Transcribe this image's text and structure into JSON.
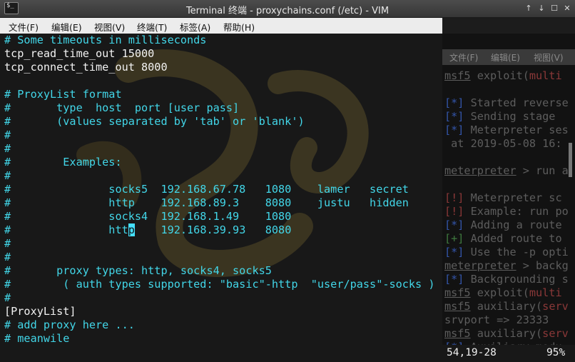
{
  "window": {
    "title": "Terminal 终端 - proxychains.conf (/etc) - VIM",
    "icon": "$_",
    "buttons": [
      "↑",
      "↓",
      "☐",
      "✕"
    ]
  },
  "menu": [
    "文件(F)",
    "编辑(E)",
    "视图(V)",
    "终端(T)",
    "标签(A)",
    "帮助(H)"
  ],
  "vim_lines": [
    {
      "text": "# Some timeouts in milliseconds",
      "type": "comment"
    },
    {
      "text": "tcp_read_time_out 15000",
      "type": "text"
    },
    {
      "text": "tcp_connect_time_out 8000",
      "type": "text"
    },
    {
      "text": "",
      "type": "text"
    },
    {
      "text": "# ProxyList format",
      "type": "comment"
    },
    {
      "text": "#       type  host  port [user pass]",
      "type": "comment"
    },
    {
      "text": "#       (values separated by 'tab' or 'blank')",
      "type": "comment"
    },
    {
      "text": "#",
      "type": "comment"
    },
    {
      "text": "#",
      "type": "comment"
    },
    {
      "text": "#        Examples:",
      "type": "comment"
    },
    {
      "text": "#",
      "type": "comment"
    },
    {
      "text": "#               socks5  192.168.67.78   1080    lamer   secret",
      "type": "comment"
    },
    {
      "text": "#               http    192.168.89.3    8080    justu   hidden",
      "type": "comment"
    },
    {
      "text": "#               socks4  192.168.1.49    1080",
      "type": "comment"
    },
    {
      "text": "#               http    192.168.39.93   8080",
      "type": "comment"
    },
    {
      "text": "#",
      "type": "comment"
    },
    {
      "text": "#",
      "type": "comment"
    },
    {
      "text": "#       proxy types: http, socks4, socks5",
      "type": "comment"
    },
    {
      "text": "#        ( auth types supported: \"basic\"-http  \"user/pass\"-socks )",
      "type": "comment"
    },
    {
      "text": "#",
      "type": "comment"
    },
    {
      "text": "[ProxyList]",
      "type": "text"
    },
    {
      "text": "# add proxy here ...",
      "type": "comment"
    },
    {
      "text": "# meanwile",
      "type": "comment"
    }
  ],
  "cursor": {
    "line": 14,
    "col": 19
  },
  "right_menu": [
    "文件(F)",
    "编辑(E)",
    "视图(V)"
  ],
  "right_lines": [
    {
      "parts": [
        {
          "t": "msf5",
          "c": "u"
        },
        {
          "t": " exploit(",
          "c": ""
        },
        {
          "t": "multi",
          "c": "red"
        }
      ]
    },
    {
      "parts": [
        {
          "t": "",
          "c": ""
        }
      ]
    },
    {
      "parts": [
        {
          "t": "[*]",
          "c": "blue"
        },
        {
          "t": " Started reverse",
          "c": ""
        }
      ]
    },
    {
      "parts": [
        {
          "t": "[*]",
          "c": "blue"
        },
        {
          "t": " Sending stage",
          "c": ""
        }
      ]
    },
    {
      "parts": [
        {
          "t": "[*]",
          "c": "blue"
        },
        {
          "t": " Meterpreter ses",
          "c": ""
        }
      ]
    },
    {
      "parts": [
        {
          "t": " at 2019-05-08 16:",
          "c": ""
        }
      ]
    },
    {
      "parts": [
        {
          "t": "",
          "c": ""
        }
      ]
    },
    {
      "parts": [
        {
          "t": "meterpreter",
          "c": "u"
        },
        {
          "t": " > run a",
          "c": ""
        }
      ]
    },
    {
      "parts": [
        {
          "t": "",
          "c": ""
        }
      ]
    },
    {
      "parts": [
        {
          "t": "[!]",
          "c": "red"
        },
        {
          "t": " Meterpreter sc",
          "c": ""
        }
      ]
    },
    {
      "parts": [
        {
          "t": "[!]",
          "c": "red"
        },
        {
          "t": " Example: run po",
          "c": ""
        }
      ]
    },
    {
      "parts": [
        {
          "t": "[*]",
          "c": "blue"
        },
        {
          "t": " Adding a route",
          "c": ""
        }
      ]
    },
    {
      "parts": [
        {
          "t": "[+]",
          "c": "green"
        },
        {
          "t": " Added route to",
          "c": ""
        }
      ]
    },
    {
      "parts": [
        {
          "t": "[*]",
          "c": "blue"
        },
        {
          "t": " Use the -p opti",
          "c": ""
        }
      ]
    },
    {
      "parts": [
        {
          "t": "meterpreter",
          "c": "u"
        },
        {
          "t": " > backg",
          "c": ""
        }
      ]
    },
    {
      "parts": [
        {
          "t": "[*]",
          "c": "blue"
        },
        {
          "t": " Backgrounding s",
          "c": ""
        }
      ]
    },
    {
      "parts": [
        {
          "t": "msf5",
          "c": "u"
        },
        {
          "t": " exploit(",
          "c": ""
        },
        {
          "t": "multi",
          "c": "red"
        }
      ]
    },
    {
      "parts": [
        {
          "t": "msf5",
          "c": "u"
        },
        {
          "t": " auxiliary(",
          "c": ""
        },
        {
          "t": "serv",
          "c": "red"
        }
      ]
    },
    {
      "parts": [
        {
          "t": "srvport => 23333",
          "c": ""
        }
      ]
    },
    {
      "parts": [
        {
          "t": "msf5",
          "c": "u"
        },
        {
          "t": " auxiliary(",
          "c": ""
        },
        {
          "t": "serv",
          "c": "red"
        }
      ]
    },
    {
      "parts": [
        {
          "t": "[*]",
          "c": "blue"
        },
        {
          "t": " Auxiliary modu",
          "c": ""
        }
      ]
    }
  ],
  "status": {
    "position": "54,19-28",
    "percent": "95%"
  },
  "colors": {
    "comment": "#42d6e8",
    "text": "#f2f2f2",
    "cursor": "#45e0ff",
    "background": "#181818"
  }
}
